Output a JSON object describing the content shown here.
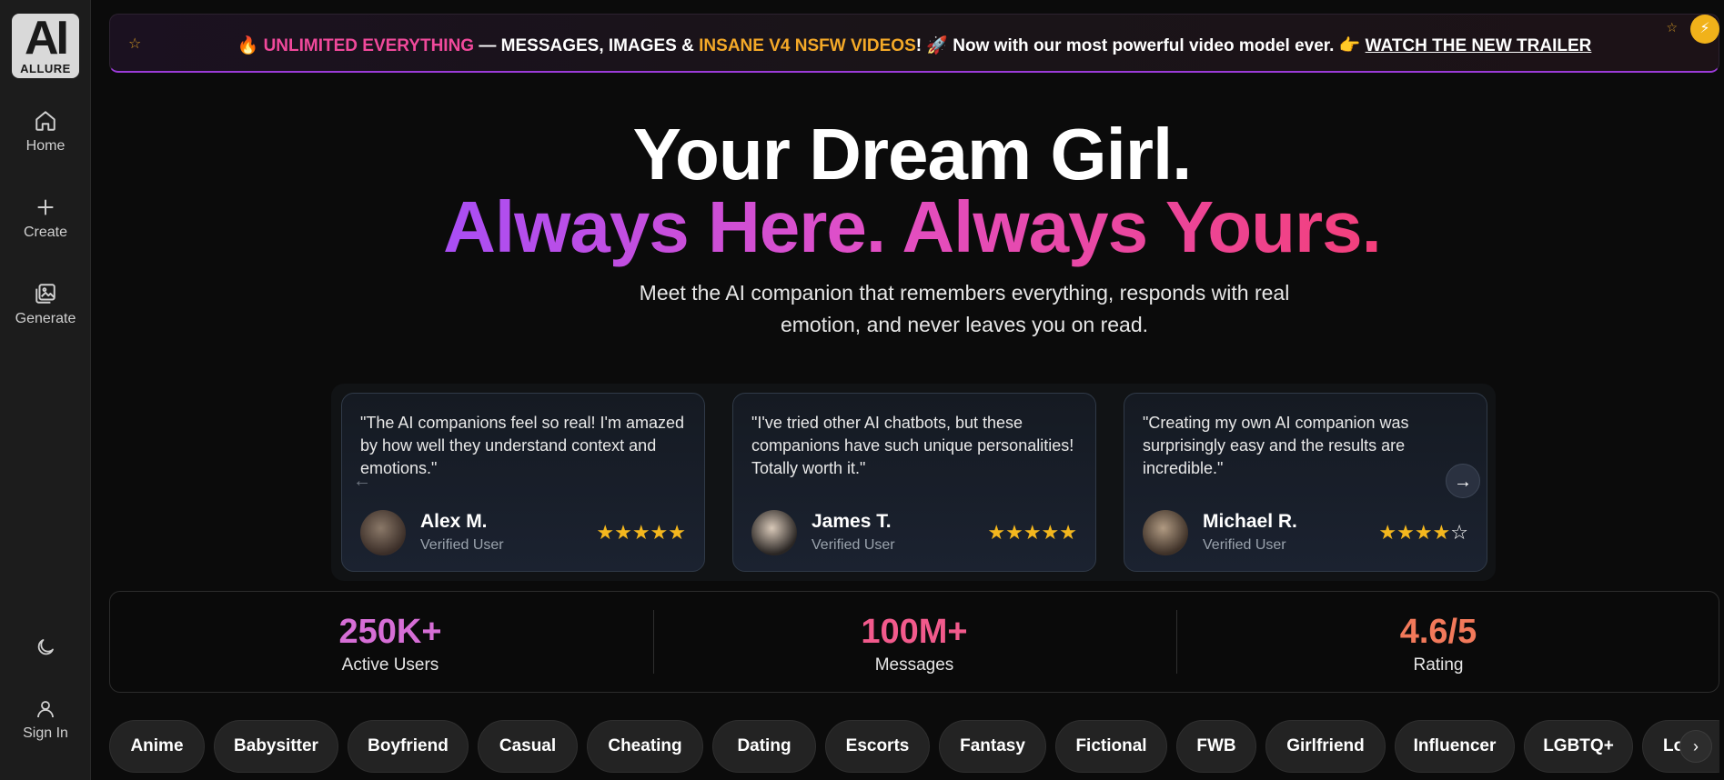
{
  "brand": {
    "logo_letters": "AI",
    "logo_word": "ALLURE"
  },
  "sidebar": {
    "items": [
      {
        "label": "Home",
        "icon": "home-icon"
      },
      {
        "label": "Create",
        "icon": "plus-icon"
      },
      {
        "label": "Generate",
        "icon": "gallery-icon"
      }
    ],
    "theme_icon": "moon-icon",
    "sign_in_label": "Sign In"
  },
  "banner": {
    "emoji_fire": "🔥",
    "part1": "UNLIMITED EVERYTHING",
    "part2": " — MESSAGES, IMAGES & ",
    "part3": "INSANE V4 NSFW VIDEOS",
    "part4": "! 🚀 Now with our most powerful video model ever. 👉 ",
    "link": "WATCH THE NEW TRAILER"
  },
  "hero": {
    "line1": "Your Dream Girl.",
    "line2": "Always Here. Always Yours.",
    "subtitle": "Meet the AI companion that remembers everything, responds with real emotion, and never leaves you on read."
  },
  "testimonials": [
    {
      "quote": "\"The AI companions feel so real! I'm amazed by how well they understand context and emotions.\"",
      "name": "Alex M.",
      "role": "Verified User",
      "rating": 5
    },
    {
      "quote": "\"I've tried other AI chatbots, but these companions have such unique personalities! Totally worth it.\"",
      "name": "James T.",
      "role": "Verified User",
      "rating": 5
    },
    {
      "quote": "\"Creating my own AI companion was surprisingly easy and the results are incredible.\"",
      "name": "Michael R.",
      "role": "Verified User",
      "rating": 4
    }
  ],
  "stats": [
    {
      "value": "250K+",
      "label": "Active Users",
      "color": "#d66ed6"
    },
    {
      "value": "100M+",
      "label": "Messages",
      "color": "#f25a8c"
    },
    {
      "value": "4.6/5",
      "label": "Rating",
      "color": "#f2795a"
    }
  ],
  "categories": [
    "Anime",
    "Babysitter",
    "Boyfriend",
    "Casual",
    "Cheating",
    "Dating",
    "Escorts",
    "Fantasy",
    "Fictional",
    "FWB",
    "Girlfriend",
    "Influencer",
    "LGBTQ+",
    "Lo"
  ],
  "colors": {
    "accent_pink": "#f0499b",
    "accent_gold": "#f4a928",
    "star": "#f4b71e"
  }
}
